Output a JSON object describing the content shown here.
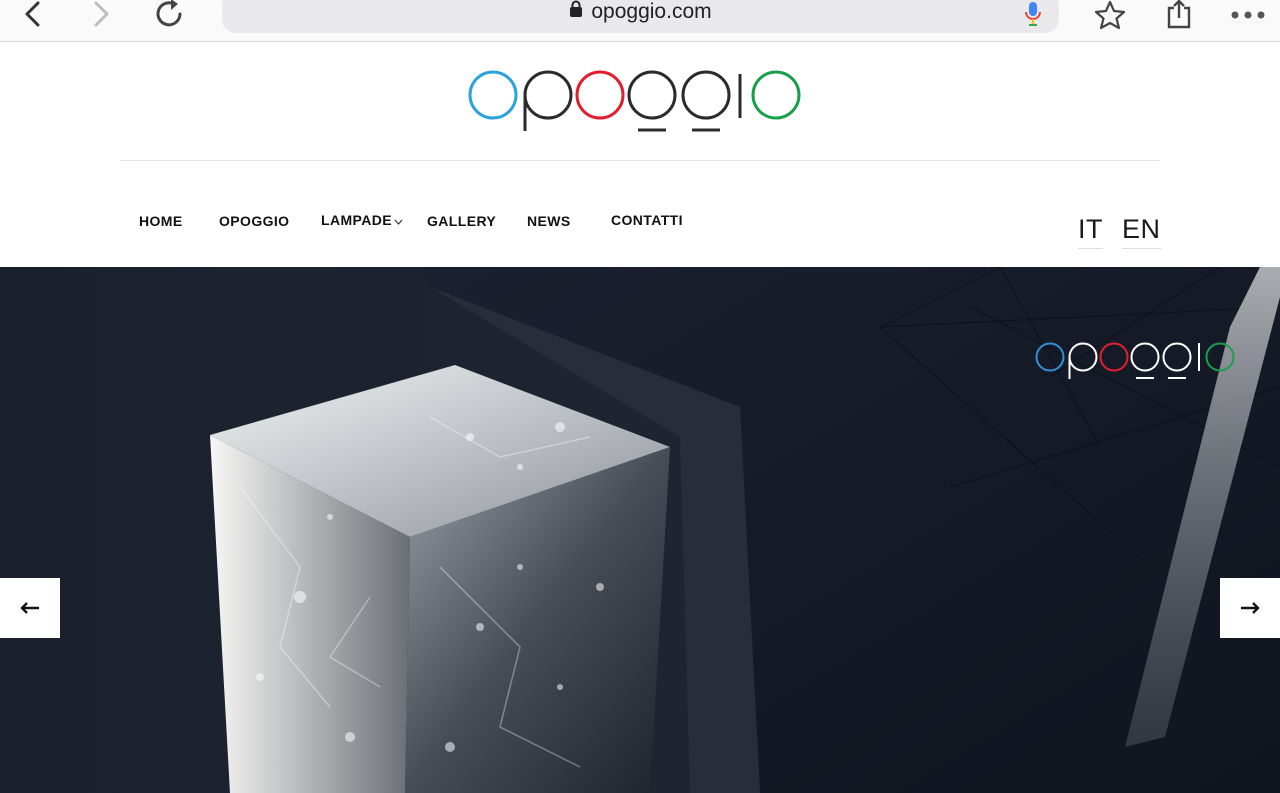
{
  "browser": {
    "url": "opoggio.com",
    "back_icon": "chevron-left-icon",
    "forward_icon": "chevron-right-icon",
    "reload_icon": "reload-icon",
    "bookmark_icon": "star-icon",
    "share_icon": "share-icon",
    "more_icon": "more-dots-icon"
  },
  "site": {
    "logo_text": "opoggio",
    "logo_colors": {
      "blue": "#2aa3dc",
      "red": "#e2202f",
      "green": "#19a04b",
      "dark": "#2b2b2b"
    }
  },
  "nav": {
    "items": [
      {
        "label": "HOME"
      },
      {
        "label": "OPOGGIO"
      },
      {
        "label": "LAMPADE"
      },
      {
        "label": "GALLERY"
      },
      {
        "label": "NEWS"
      },
      {
        "label": "CONTATTI"
      }
    ]
  },
  "language": {
    "it": "IT",
    "en": "EN"
  },
  "slider": {
    "prev_icon": "arrow-left-icon",
    "next_icon": "arrow-right-icon",
    "overlay_logo_text": "opoggio"
  }
}
